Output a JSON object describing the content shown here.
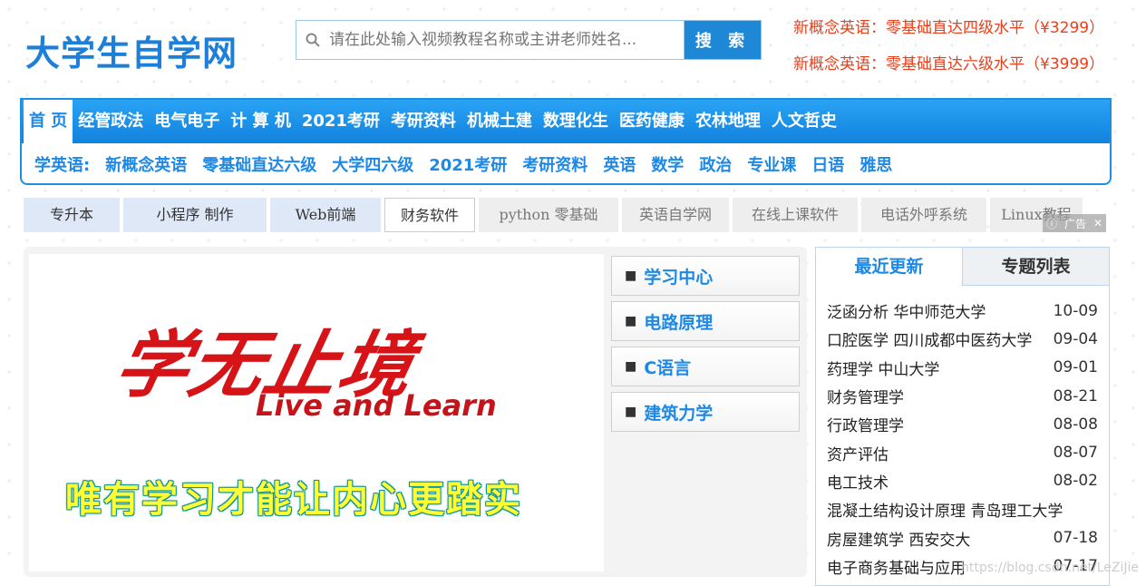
{
  "header": {
    "logo": "大学生自学网",
    "search_placeholder": "请在此处输入视频教程名称或主讲老师姓名...",
    "search_button": "搜 索",
    "promos": [
      "新概念英语：零基础直达四级水平（¥3299）",
      "新概念英语：零基础直达六级水平（¥3999）"
    ]
  },
  "nav": {
    "main": [
      "首 页",
      "经管政法",
      "电气电子",
      "计 算 机",
      "2021考研",
      "考研资料",
      "机械土建",
      "数理化生",
      "医药健康",
      "农林地理",
      "人文哲史"
    ],
    "sub": [
      "学英语:",
      "新概念英语",
      "零基础直达六级",
      "大学四六级",
      "2021考研",
      "考研资料",
      "英语",
      "数学",
      "政治",
      "专业课",
      "日语",
      "雅思"
    ]
  },
  "tags": [
    "专升本",
    "小程序 制作",
    "Web前端",
    "财务软件",
    "python 零基础",
    "英语自学网",
    "在线上课软件",
    "电话外呼系统",
    "Linux教程"
  ],
  "ad_close": {
    "info": "ⓘ",
    "label": "广告",
    "x": "✕"
  },
  "banner": {
    "title": "学无止境",
    "subtitle": "Live and Learn",
    "slogan": "唯有学习才能让内心更踏实"
  },
  "side_links": [
    "学习中心",
    "电路原理",
    "C语言",
    "建筑力学"
  ],
  "side_box": {
    "tabs": [
      "最近更新",
      "专题列表"
    ],
    "items": [
      {
        "name": "泛函分析 华中师范大学",
        "date": "10-09"
      },
      {
        "name": "口腔医学 四川成都中医药大学",
        "date": "09-04"
      },
      {
        "name": "药理学 中山大学",
        "date": "09-01"
      },
      {
        "name": "财务管理学",
        "date": "08-21"
      },
      {
        "name": "行政管理学",
        "date": "08-08"
      },
      {
        "name": "资产评估",
        "date": "08-07"
      },
      {
        "name": "电工技术",
        "date": "08-02"
      },
      {
        "name": "混凝土结构设计原理 青岛理工大学",
        "date": ""
      },
      {
        "name": "房屋建筑学 西安交大",
        "date": "07-18"
      },
      {
        "name": "电子商务基础与应用",
        "date": "07-17"
      }
    ]
  },
  "watermark": "https://blog.csdn.net/LeZiJie"
}
